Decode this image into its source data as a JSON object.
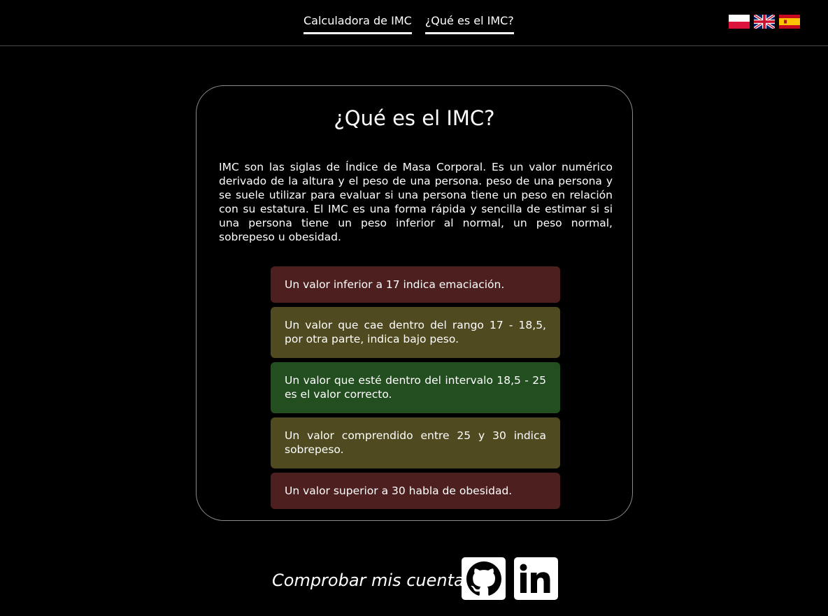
{
  "nav": {
    "items": [
      {
        "label": "Calculadora de IMC"
      },
      {
        "label": "¿Qué es el IMC?"
      }
    ]
  },
  "languages": [
    {
      "icon": "flag-poland-icon"
    },
    {
      "icon": "flag-uk-icon"
    },
    {
      "icon": "flag-spain-icon"
    }
  ],
  "card": {
    "title": "¿Qué es el IMC?",
    "intro": "IMC son las siglas de Índice de Masa Corporal. Es un valor numérico derivado de la altura y el peso de una persona. peso de una persona y se suele utilizar para evaluar si una persona tiene un peso en relación con su estatura. El IMC es una forma rápida y sencilla de estimar si si una persona tiene un peso inferior al normal, un peso normal, sobrepeso u obesidad.",
    "ranges": [
      {
        "text": "Un valor inferior a 17 indica emaciación.",
        "color": "#4d1f1f"
      },
      {
        "text": "Un valor que cae dentro del rango 17 - 18,5, por otra parte, indica bajo peso.",
        "color": "#4f4a20"
      },
      {
        "text": "Un valor que esté dentro del intervalo 18,5 - 25 es el valor correcto.",
        "color": "#234e1f"
      },
      {
        "text": "Un valor comprendido entre 25 y 30 indica sobrepeso.",
        "color": "#4f4a20"
      },
      {
        "text": "Un valor superior a 30 habla de obesidad.",
        "color": "#4d1f1f"
      }
    ]
  },
  "footer": {
    "text": "Comprobar mis cuentas",
    "links": [
      {
        "icon": "github-icon"
      },
      {
        "icon": "linkedin-icon"
      }
    ]
  }
}
